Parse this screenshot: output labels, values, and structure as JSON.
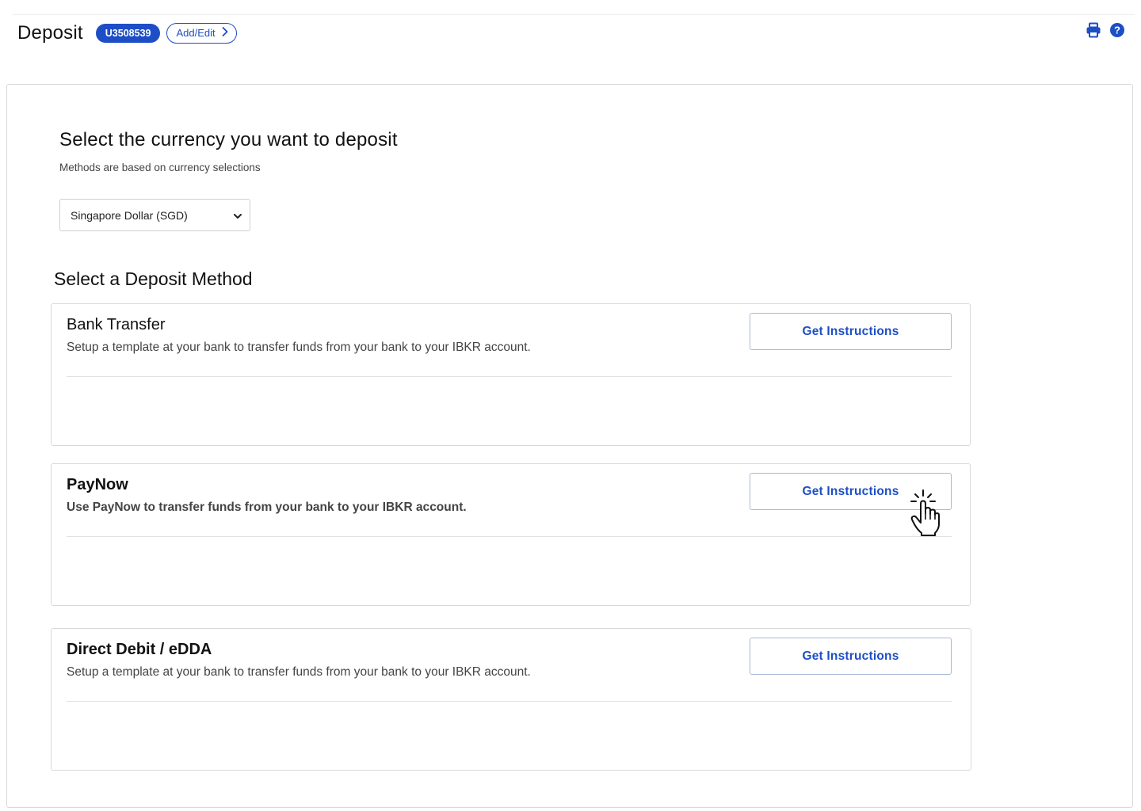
{
  "header": {
    "title": "Deposit",
    "account_id": "U3508539",
    "add_edit_label": "Add/Edit",
    "icons": [
      "printer-icon",
      "help-icon"
    ]
  },
  "currency": {
    "title": "Select the currency you want to deposit",
    "subtitle": "Methods are based on currency selections",
    "selected": "Singapore Dollar (SGD)"
  },
  "methods_section": {
    "title": "Select a Deposit Method",
    "items": [
      {
        "name": "Bank Transfer",
        "description": "Setup a template at your bank to transfer funds from your bank to your IBKR account.",
        "button_label": "Get Instructions"
      },
      {
        "name": "PayNow",
        "description": "Use PayNow to transfer funds from your bank to your IBKR account.",
        "button_label": "Get Instructions"
      },
      {
        "name": "Direct Debit / eDDA",
        "description": "Setup a template at your bank to transfer funds from your bank to your IBKR account.",
        "button_label": "Get Instructions"
      }
    ]
  },
  "colors": {
    "accent": "#1d4ec6",
    "border": "#d9d9d9"
  }
}
